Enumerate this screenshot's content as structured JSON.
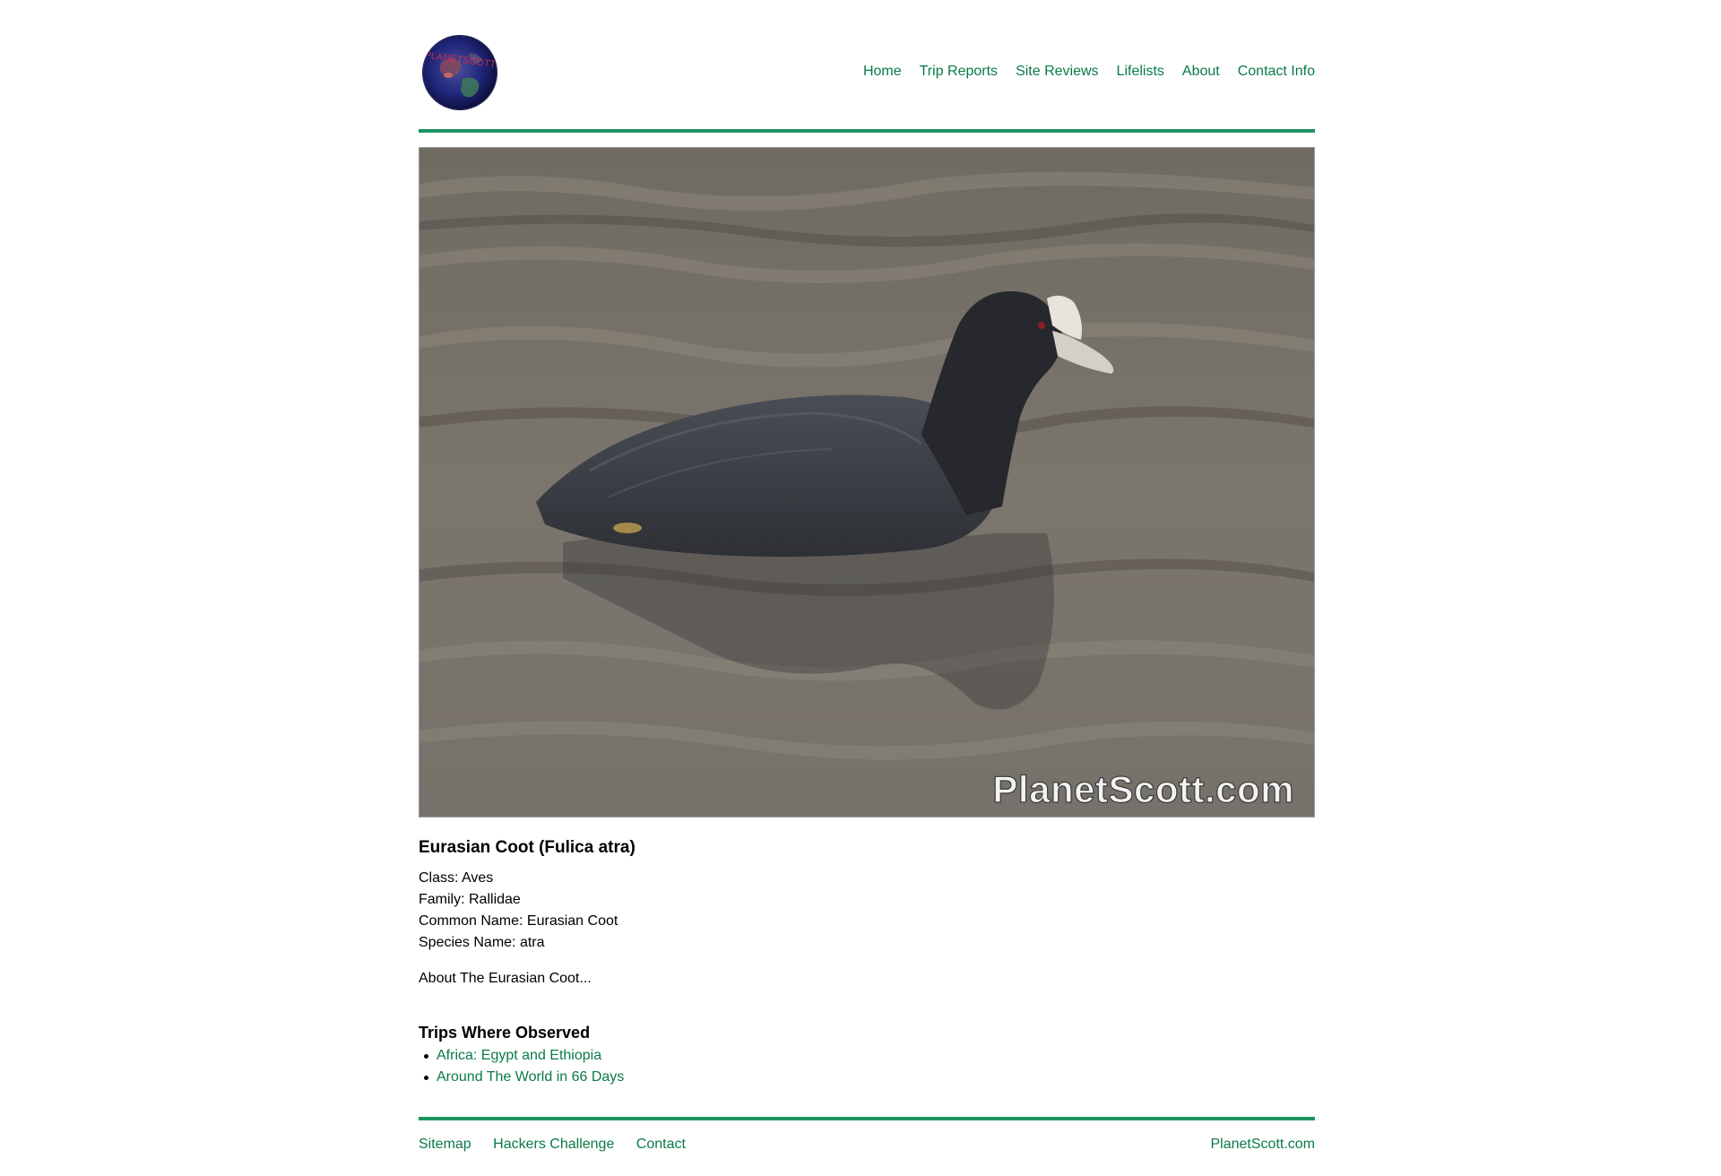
{
  "header": {
    "logo_text": "PLANETSCOTT",
    "nav": [
      "Home",
      "Trip Reports",
      "Site Reviews",
      "Lifelists",
      "About",
      "Contact Info"
    ]
  },
  "hero": {
    "watermark": "PlanetScott.com"
  },
  "species": {
    "title": "Eurasian Coot (Fulica atra)",
    "class_line": "Class: Aves",
    "family_line": "Family: Rallidae",
    "common_line": "Common Name: Eurasian Coot",
    "species_line": "Species Name: atra",
    "about": "About The Eurasian Coot..."
  },
  "trips": {
    "heading": "Trips Where Observed",
    "items": [
      "Africa: Egypt and Ethiopia",
      "Around The World in 66 Days"
    ]
  },
  "footer": {
    "links": [
      "Sitemap",
      "Hackers Challenge",
      "Contact"
    ],
    "site": "PlanetScott.com"
  },
  "colors": {
    "link": "#0a7a46",
    "rule": "#1b9462"
  }
}
